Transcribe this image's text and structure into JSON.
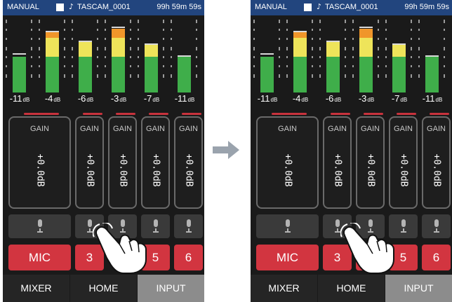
{
  "status": {
    "mode": "MANUAL",
    "note_glyph": "♪",
    "file": "TASCAM_0001",
    "remaining": "99h 59m 59s"
  },
  "meters": [
    {
      "db": "-11",
      "unit": "dB",
      "green": 0.47,
      "yellow": 0.0,
      "orange": 0.0,
      "peak": 0.5
    },
    {
      "db": "-4",
      "unit": "dB",
      "green": 0.47,
      "yellow": 0.25,
      "orange": 0.08,
      "peak": 0.8
    },
    {
      "db": "-6",
      "unit": "dB",
      "green": 0.47,
      "yellow": 0.2,
      "orange": 0.0,
      "peak": 0.67
    },
    {
      "db": "-3",
      "unit": "dB",
      "green": 0.47,
      "yellow": 0.25,
      "orange": 0.12,
      "peak": 0.85
    },
    {
      "db": "-7",
      "unit": "dB",
      "green": 0.47,
      "yellow": 0.16,
      "orange": 0.0,
      "peak": 0.63
    },
    {
      "db": "-11",
      "unit": "dB",
      "green": 0.47,
      "yellow": 0.0,
      "orange": 0.0,
      "peak": 0.47
    }
  ],
  "channels": [
    {
      "gain_label": "GAIN",
      "gain_value": "+0.0dB"
    },
    {
      "gain_label": "GAIN",
      "gain_value": "+0.0dB"
    },
    {
      "gain_label": "GAIN",
      "gain_value": "+0.0dB"
    },
    {
      "gain_label": "GAIN",
      "gain_value": "+0.0dB"
    },
    {
      "gain_label": "GAIN",
      "gain_value": "+0.0dB"
    }
  ],
  "buttons": {
    "mic": "MIC",
    "ch3": "3",
    "ch5": "5",
    "ch6": "6"
  },
  "tabs": {
    "mixer": "MIXER",
    "home": "HOME",
    "input": "INPUT"
  },
  "colors": {
    "status_bar": "#22457e",
    "active_button": "#d23540",
    "meter_green": "#3fae4a",
    "meter_yellow": "#eee45a",
    "meter_orange": "#f0962a"
  }
}
